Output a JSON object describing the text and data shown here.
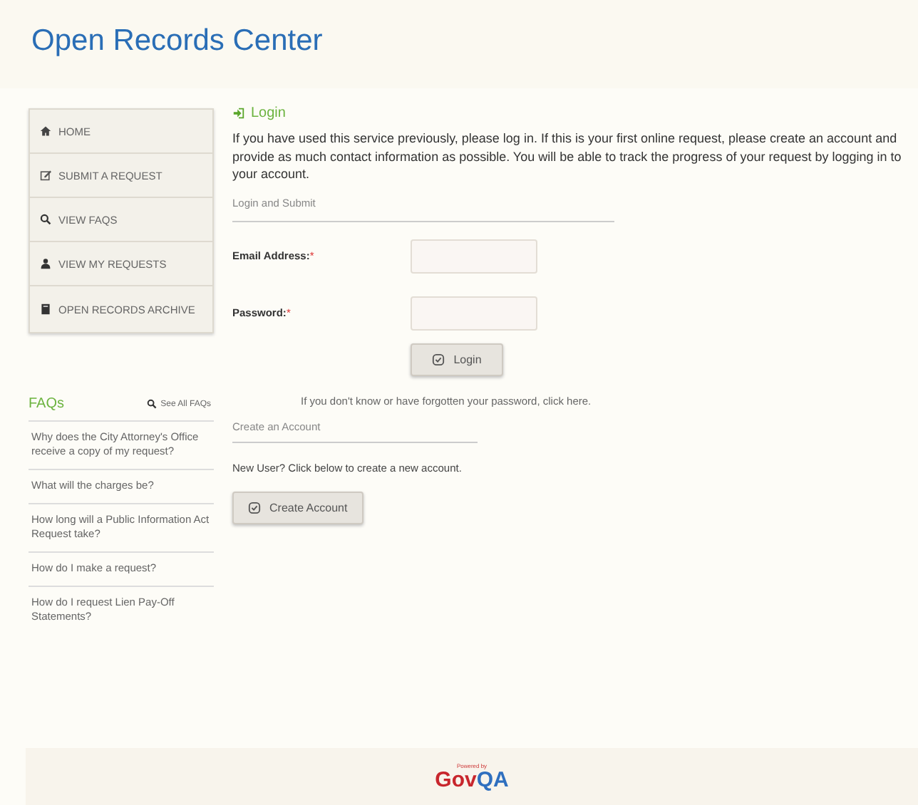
{
  "header": {
    "title": "Open Records Center"
  },
  "nav": [
    {
      "label": "HOME",
      "kind": "home"
    },
    {
      "label": "SUBMIT A REQUEST",
      "kind": "edit"
    },
    {
      "label": "VIEW FAQS",
      "kind": "search"
    },
    {
      "label": "VIEW MY REQUESTS",
      "kind": "user"
    },
    {
      "label": "OPEN RECORDS ARCHIVE",
      "kind": "book"
    }
  ],
  "faqs": {
    "title": "FAQs",
    "see_all": "See All FAQs",
    "items": [
      "Why does the City Attorney's Office receive a copy of my request?",
      "What will the charges be?",
      "How long will a Public Information Act Request take?",
      "How do I make a request?",
      "How do I request Lien Pay-Off Statements?"
    ]
  },
  "login": {
    "title": "Login",
    "intro": "If you have used this service previously, please log in. If this is your first online request, please create an account and provide as much contact information as possible. You will be able to track the progress of your request by logging in to your account.",
    "section": "Login and Submit",
    "fields": [
      {
        "label": "Email Address:",
        "mark": "*"
      },
      {
        "label": "Password:",
        "mark": "*"
      }
    ],
    "button": "Login",
    "forgot": "If you don't know or have forgotten your password, click here."
  },
  "create": {
    "section": "Create an Account",
    "text": "New User? Click below to create a new account.",
    "button": "Create Account"
  },
  "footer": {
    "tagline": "Powered by",
    "brand_1": "Gov",
    "brand_2": "QA"
  }
}
